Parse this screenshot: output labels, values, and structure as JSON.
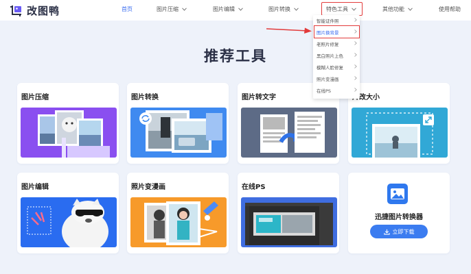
{
  "header": {
    "brand": "改图鸭",
    "nav": [
      {
        "label": "首页",
        "active": true,
        "has_dropdown": false
      },
      {
        "label": "图片压缩",
        "active": false,
        "has_dropdown": true
      },
      {
        "label": "图片编辑",
        "active": false,
        "has_dropdown": true
      },
      {
        "label": "图片转换",
        "active": false,
        "has_dropdown": true
      },
      {
        "label": "特色工具",
        "active": false,
        "has_dropdown": true,
        "highlighted": true
      },
      {
        "label": "其他功能",
        "active": false,
        "has_dropdown": true
      },
      {
        "label": "使用帮助",
        "active": false,
        "has_dropdown": false
      }
    ]
  },
  "dropdown": {
    "items": [
      {
        "label": "智能证件照",
        "highlighted": false
      },
      {
        "label": "图片换背景",
        "highlighted": true
      },
      {
        "label": "老照片修复",
        "highlighted": false
      },
      {
        "label": "黑白照片上色",
        "highlighted": false
      },
      {
        "label": "模糊人脸修复",
        "highlighted": false
      },
      {
        "label": "照片变漫画",
        "highlighted": false
      },
      {
        "label": "在线PS",
        "highlighted": false
      }
    ]
  },
  "main": {
    "title": "推荐工具",
    "cards": [
      {
        "title": "图片压缩",
        "icon": "compress-illustration"
      },
      {
        "title": "图片转换",
        "icon": "convert-illustration"
      },
      {
        "title": "图片转文字",
        "icon": "ocr-illustration"
      },
      {
        "title": "片改大小",
        "icon": "resize-illustration"
      },
      {
        "title": "图片编辑",
        "icon": "edit-illustration"
      },
      {
        "title": "照片变漫画",
        "icon": "cartoon-illustration"
      },
      {
        "title": "在线PS",
        "icon": "photoshop-illustration"
      }
    ],
    "promo": {
      "title": "迅捷图片转换器",
      "button_label": "立即下载",
      "icon": "image-app-icon"
    }
  },
  "colors": {
    "accent": "#3b6df0",
    "highlight_box": "#e23a3a",
    "page_background": "#eef2fa"
  }
}
